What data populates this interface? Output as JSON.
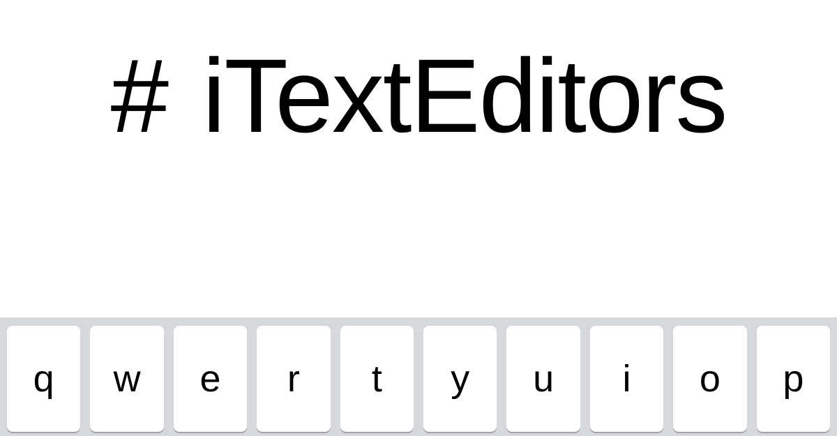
{
  "title": {
    "hash": "#",
    "text": "iTextEditors"
  },
  "keyboard": {
    "row1": [
      {
        "label": "q"
      },
      {
        "label": "w"
      },
      {
        "label": "e"
      },
      {
        "label": "r"
      },
      {
        "label": "t"
      },
      {
        "label": "y"
      },
      {
        "label": "u"
      },
      {
        "label": "i"
      },
      {
        "label": "o"
      },
      {
        "label": "p"
      }
    ]
  }
}
